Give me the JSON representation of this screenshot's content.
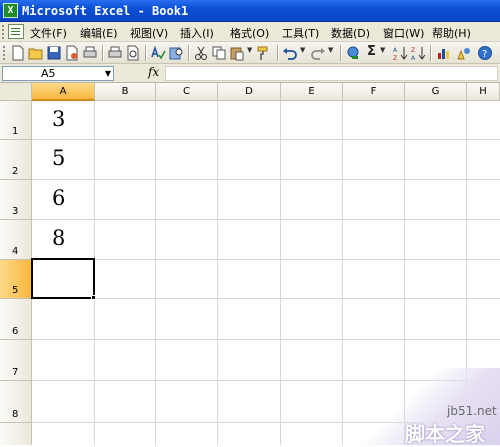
{
  "window": {
    "title": "Microsoft Excel - Book1"
  },
  "menu": {
    "items": [
      "文件(F)",
      "编辑(E)",
      "视图(V)",
      "插入(I)",
      "格式(O)",
      "工具(T)",
      "数据(D)",
      "窗口(W)",
      "帮助(H)"
    ]
  },
  "toolbar": {
    "sigma": "Σ",
    "icons": [
      "new-icon",
      "open-icon",
      "save-icon",
      "permission-icon",
      "print-icon",
      "print-preview-icon",
      "spelling-icon",
      "research-icon",
      "cut-icon",
      "copy-icon",
      "paste-icon",
      "format-painter-icon",
      "undo-icon",
      "redo-icon",
      "hyperlink-icon",
      "autosum-icon",
      "sort-ascending-icon",
      "sort-descending-icon",
      "chart-wizard-icon",
      "help-icon"
    ]
  },
  "formula_bar": {
    "name_box": "A5",
    "fx_label": "fx",
    "content": ""
  },
  "grid": {
    "columns": [
      "A",
      "B",
      "C",
      "D",
      "E",
      "F",
      "G",
      "H"
    ],
    "rows": [
      "1",
      "2",
      "3",
      "4",
      "5",
      "6",
      "7",
      "8"
    ],
    "active_cell": "A5",
    "cells": {
      "A1": "3",
      "A2": "5",
      "A3": "6",
      "A4": "8"
    }
  },
  "watermark": {
    "url": "jb51.net",
    "brand": "脚本之家"
  },
  "colors": {
    "title_bar": "#0b4fd6",
    "chrome": "#ece9d8",
    "active_header": "#f7b73c"
  }
}
